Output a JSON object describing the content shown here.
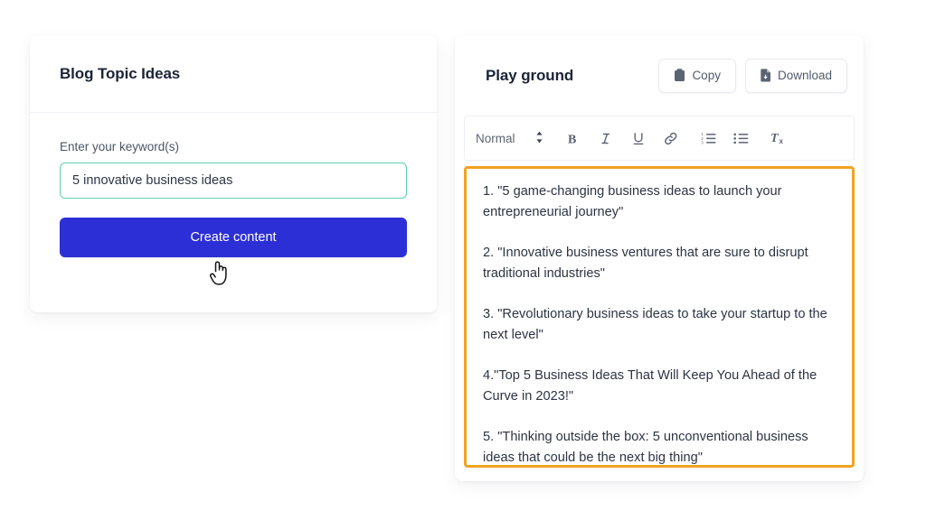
{
  "colors": {
    "primary_button": "#2d2fd6",
    "input_border": "#5ecfb0",
    "editor_border": "#f0a421",
    "text": "#2c3442",
    "background": "#ffffff"
  },
  "left_panel": {
    "title": "Blog Topic Ideas",
    "field_label": "Enter your keyword(s)",
    "input_value": "5 innovative business ideas",
    "input_placeholder": "Enter your keyword(s)",
    "submit_label": "Create content"
  },
  "right_panel": {
    "title": "Play ground",
    "actions": [
      {
        "label": "Copy",
        "icon": "clipboard-icon"
      },
      {
        "label": "Download",
        "icon": "file-download-icon"
      }
    ],
    "toolbar": {
      "format_select": "Normal",
      "format_select_icon": "chevron-updown-icon",
      "buttons": [
        {
          "name": "bold-icon",
          "label": "B"
        },
        {
          "name": "italic-icon",
          "label": "I"
        },
        {
          "name": "underline-icon",
          "label": "U"
        },
        {
          "name": "link-icon",
          "label": ""
        },
        {
          "name": "ordered-list-icon",
          "label": ""
        },
        {
          "name": "bullet-list-icon",
          "label": ""
        },
        {
          "name": "clear-format-icon",
          "label": ""
        }
      ]
    },
    "editor_content": [
      "1. \"5 game-changing business ideas to launch your entrepreneurial journey\"",
      "2. \"Innovative business ventures that are sure to disrupt traditional industries\"",
      "3. \"Revolutionary business ideas to take your startup to the next level\"",
      "4.\"Top 5 Business Ideas That Will Keep You Ahead of the Curve in 2023!\"",
      "5. \"Thinking outside the box: 5 unconventional business ideas that could be the next big thing\""
    ]
  },
  "cursor": {
    "icon": "pointing-hand-cursor"
  }
}
